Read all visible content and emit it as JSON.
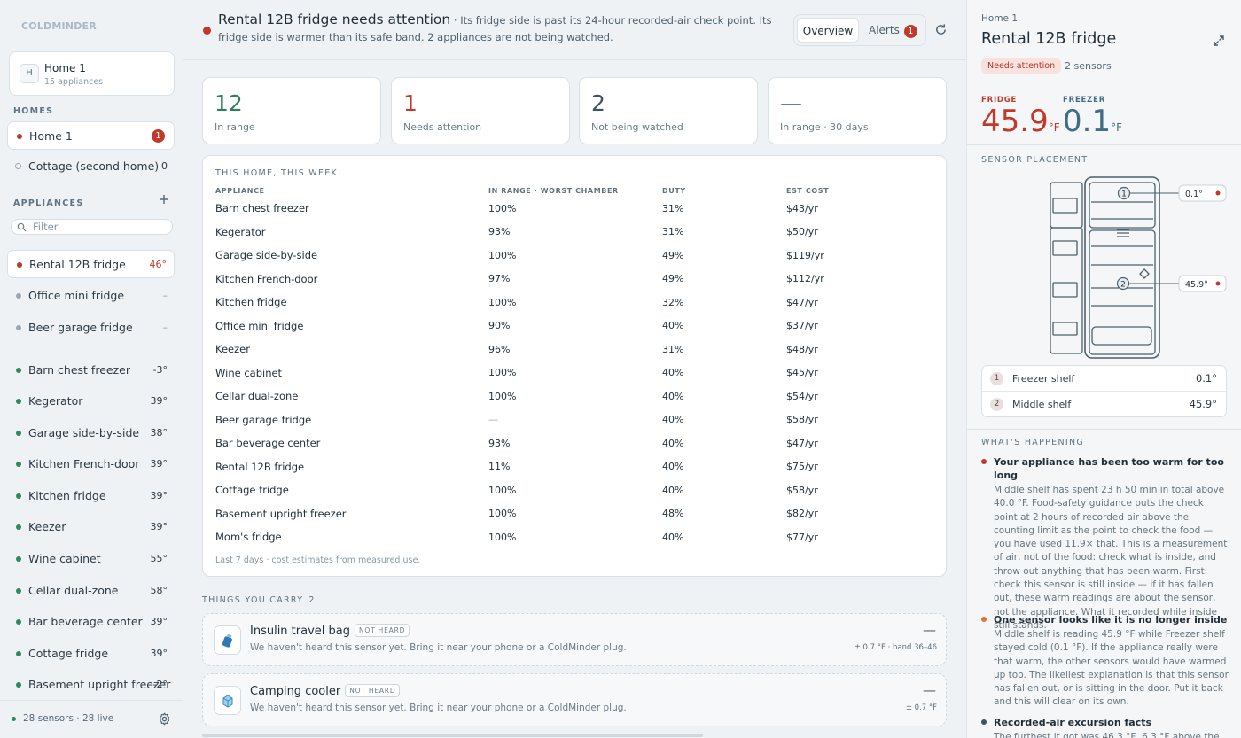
{
  "app": {
    "logo": "COLDMINDER"
  },
  "sidebar": {
    "home_card": {
      "avatar": "H",
      "name": "Home 1",
      "sub": "15 appliances"
    },
    "homes_label": "HOMES",
    "homes": [
      {
        "name": "Home 1",
        "badge": "1",
        "selected": true
      },
      {
        "name": "Cottage (second home)",
        "count": "0"
      }
    ],
    "appliances_label": "APPLIANCES",
    "filter_placeholder": "Filter",
    "appliances": [
      {
        "name": "Rental 12B fridge",
        "value": "46°",
        "status": "alert",
        "selected": true
      },
      {
        "name": "Office mini fridge",
        "value": "–",
        "status": "grey"
      },
      {
        "name": "Beer garage fridge",
        "value": "–",
        "status": "grey"
      },
      {
        "name": "Barn chest freezer",
        "value": "-3°",
        "status": "ok"
      },
      {
        "name": "Kegerator",
        "value": "39°",
        "status": "ok"
      },
      {
        "name": "Garage side-by-side",
        "value": "38°",
        "status": "ok"
      },
      {
        "name": "Kitchen French-door",
        "value": "39°",
        "status": "ok"
      },
      {
        "name": "Kitchen fridge",
        "value": "39°",
        "status": "ok"
      },
      {
        "name": "Keezer",
        "value": "39°",
        "status": "ok"
      },
      {
        "name": "Wine cabinet",
        "value": "55°",
        "status": "ok"
      },
      {
        "name": "Cellar dual-zone",
        "value": "58°",
        "status": "ok"
      },
      {
        "name": "Bar beverage center",
        "value": "39°",
        "status": "ok"
      },
      {
        "name": "Cottage fridge",
        "value": "39°",
        "status": "ok"
      },
      {
        "name": "Basement upright freezer",
        "value": "-2°",
        "status": "ok"
      }
    ],
    "footer": "28 sensors · 28 live"
  },
  "banner": {
    "title": "Rental 12B fridge needs attention",
    "text": " · Its fridge side is past its 24-hour recorded-air check point. Its fridge side is warmer than its safe band. 2 appliances are not being watched.",
    "tab_overview": "Overview",
    "tab_alerts": "Alerts",
    "alerts_count": "1"
  },
  "stats": [
    {
      "value": "12",
      "label": "In range"
    },
    {
      "value": "1",
      "label": "Needs attention"
    },
    {
      "value": "2",
      "label": "Not being watched"
    },
    {
      "value": "—",
      "label": "In range · 30 days"
    }
  ],
  "week": {
    "heading": "THIS HOME, THIS WEEK",
    "columns": [
      "APPLIANCE",
      "IN RANGE · WORST CHAMBER",
      "DUTY",
      "EST COST"
    ],
    "rows": [
      [
        "Barn chest freezer",
        "100%",
        "31%",
        "$43/yr"
      ],
      [
        "Kegerator",
        "93%",
        "31%",
        "$50/yr"
      ],
      [
        "Garage side-by-side",
        "100%",
        "49%",
        "$119/yr"
      ],
      [
        "Kitchen French-door",
        "97%",
        "49%",
        "$112/yr"
      ],
      [
        "Kitchen fridge",
        "100%",
        "32%",
        "$47/yr"
      ],
      [
        "Office mini fridge",
        "90%",
        "40%",
        "$37/yr"
      ],
      [
        "Keezer",
        "96%",
        "31%",
        "$48/yr"
      ],
      [
        "Wine cabinet",
        "100%",
        "40%",
        "$45/yr"
      ],
      [
        "Cellar dual-zone",
        "100%",
        "40%",
        "$54/yr"
      ],
      [
        "Beer garage fridge",
        "—",
        "40%",
        "$58/yr"
      ],
      [
        "Bar beverage center",
        "93%",
        "40%",
        "$47/yr"
      ],
      [
        "Rental 12B fridge",
        "11%",
        "40%",
        "$75/yr"
      ],
      [
        "Cottage fridge",
        "100%",
        "40%",
        "$58/yr"
      ],
      [
        "Basement upright freezer",
        "100%",
        "48%",
        "$82/yr"
      ],
      [
        "Mom's fridge",
        "100%",
        "40%",
        "$77/yr"
      ]
    ],
    "footnote": "Last 7 days · cost estimates from measured use."
  },
  "carry": {
    "heading": "THINGS YOU CARRY",
    "count": "2",
    "items": [
      {
        "name": "Insulin travel bag",
        "tag": "NOT HEARD",
        "desc": "We haven't heard this sensor yet. Bring it near your phone or a ColdMinder plug.",
        "dash": "—",
        "range": "± 0.7 °F · band 36–46",
        "icon": "bag-icon"
      },
      {
        "name": "Camping cooler",
        "tag": "NOT HEARD",
        "desc": "We haven't heard this sensor yet. Bring it near your phone or a ColdMinder plug.",
        "dash": "—",
        "range": "± 0.7 °F",
        "icon": "cooler-icon"
      }
    ]
  },
  "panel": {
    "crumb": "Home 1",
    "title": "Rental 12B fridge",
    "pill": "Needs attention",
    "sensors_count": "2 sensors",
    "fridge_label": "FRIDGE",
    "fridge_value": "45.9",
    "freezer_label": "FREEZER",
    "freezer_value": "0.1",
    "unit": "°F",
    "placement_heading": "SENSOR PLACEMENT",
    "callouts": [
      {
        "num": "1",
        "value": "0.1°"
      },
      {
        "num": "2",
        "value": "45.9°"
      }
    ],
    "sensors": [
      {
        "num": "1",
        "name": "Freezer shelf",
        "value": "0.1°"
      },
      {
        "num": "2",
        "name": "Middle shelf",
        "value": "45.9°"
      }
    ],
    "happening_heading": "WHAT'S HAPPENING",
    "happenings": [
      {
        "title": "Your appliance has been too warm for too long",
        "body": "Middle shelf has spent 23 h 50 min in total above 40.0 °F. Food-safety guidance puts the check point at 2 hours of recorded air above the counting limit as the point to check the food — you have used 11.9× that. This is a measurement of air, not of the food: check what is inside, and throw out anything that has been warm. First check this sensor is still inside — if it has fallen out, these warm readings are about the sensor, not the appliance. What it recorded while inside still stands."
      },
      {
        "title": "One sensor looks like it is no longer inside",
        "body": "Middle shelf is reading 45.9 °F while Freezer shelf stayed cold (0.1 °F). If the appliance really were that warm, the other sensors would have warmed up too. The likeliest explanation is that this sensor has fallen out, or is sitting in the door. Put it back and this will clear on its own."
      },
      {
        "title": "Recorded-air excursion facts",
        "body": "The furthest it got was 46.3 °F, 6.3 °F above the"
      }
    ]
  },
  "colors": {
    "alert": "#c0392b",
    "ok": "#2e8a5e",
    "grey": "#9aa8b2",
    "ink": "#1f2e38"
  }
}
